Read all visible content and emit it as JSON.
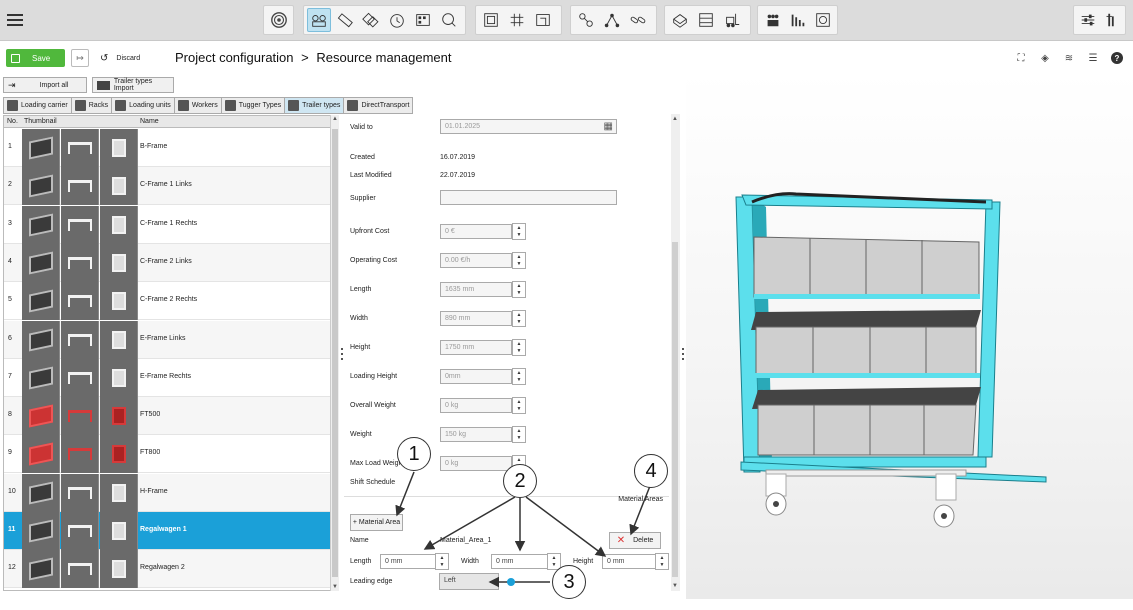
{
  "toolbar": {
    "groups": [
      {
        "items": [
          "logo-icon"
        ]
      },
      {
        "items": [
          "resources-icon",
          "ruler-icon",
          "layers-icon",
          "clock-icon",
          "grid-stack-icon",
          "search-zoom-icon"
        ],
        "active": 0
      },
      {
        "items": [
          "frame-icon",
          "grid-icon",
          "area-icon"
        ]
      },
      {
        "items": [
          "chain-link-icon",
          "network-icon",
          "link-icon"
        ]
      },
      {
        "items": [
          "box-icon",
          "rack-icon",
          "forklift-icon"
        ]
      },
      {
        "items": [
          "people-icon",
          "chart-bars-icon",
          "target-icon"
        ]
      },
      {
        "items": [
          "sliders-icon",
          "columns-icon"
        ]
      }
    ]
  },
  "header": {
    "save_label": "Save",
    "discard_label": "Discard",
    "breadcrumb_1": "Project configuration",
    "breadcrumb_sep": ">",
    "breadcrumb_2": "Resource management"
  },
  "import": {
    "import_all": "Import all",
    "trailer_import": "Trailer types Import"
  },
  "tabs": [
    {
      "label": "Loading carrier"
    },
    {
      "label": "Racks"
    },
    {
      "label": "Loading units"
    },
    {
      "label": "Workers"
    },
    {
      "label": "Tugger Types"
    },
    {
      "label": "Trailer types",
      "active": true
    },
    {
      "label": "DirectTransport"
    }
  ],
  "table": {
    "headers": {
      "no": "No.",
      "thumb": "Thumbnail",
      "name": "Name"
    },
    "rows": [
      {
        "no": "1",
        "name": "B-Frame",
        "kind": "red-none"
      },
      {
        "no": "2",
        "name": "C-Frame 1 Links"
      },
      {
        "no": "3",
        "name": "C-Frame 1 Rechts"
      },
      {
        "no": "4",
        "name": "C-Frame 2 Links"
      },
      {
        "no": "5",
        "name": "C-Frame 2 Rechts"
      },
      {
        "no": "6",
        "name": "E-Frame Links"
      },
      {
        "no": "7",
        "name": "E-Frame Rechts"
      },
      {
        "no": "8",
        "name": "FT500",
        "red": true
      },
      {
        "no": "9",
        "name": "FT800",
        "red": true
      },
      {
        "no": "10",
        "name": "H-Frame"
      },
      {
        "no": "11",
        "name": "Regalwagen 1",
        "selected": true
      },
      {
        "no": "12",
        "name": "Regalwagen 2"
      }
    ]
  },
  "form": {
    "valid_to_label": "Valid to",
    "valid_to_value": "01.01.2025",
    "created_label": "Created",
    "created_value": "16.07.2019",
    "modified_label": "Last Modified",
    "modified_value": "22.07.2019",
    "supplier_label": "Supplier",
    "supplier_value": "",
    "fields": [
      {
        "label": "Upfront Cost",
        "value": "0 €"
      },
      {
        "label": "Operating Cost",
        "value": "0.00 €/h"
      },
      {
        "label": "Length",
        "value": "1635 mm"
      },
      {
        "label": "Width",
        "value": "890 mm"
      },
      {
        "label": "Height",
        "value": "1750 mm"
      },
      {
        "label": "Loading Height",
        "value": "0mm"
      },
      {
        "label": "Overall Weight",
        "value": "0 kg"
      },
      {
        "label": "Weight",
        "value": "150 kg"
      },
      {
        "label": "Max Load Weight",
        "value": "0 kg"
      }
    ],
    "shift_label": "Shift Schedule",
    "material_areas_title": "Material Areas",
    "add_material_area": "+ Material Area",
    "delete_label": "Delete",
    "area_name_label": "Name",
    "area_name_value": "Material_Area_1",
    "area_length_label": "Length",
    "area_length_value": "0 mm",
    "area_width_label": "Width",
    "area_width_value": "0 mm",
    "area_height_label": "Height",
    "area_height_value": "0 mm",
    "leading_edge_label": "Leading edge",
    "leading_edge_value": "Left"
  },
  "callouts": [
    "1",
    "2",
    "3",
    "4"
  ],
  "colors": {
    "accent": "#1ba0d8",
    "save": "#50b83c",
    "frame": "#5cdfec",
    "annotation": "#333333"
  }
}
